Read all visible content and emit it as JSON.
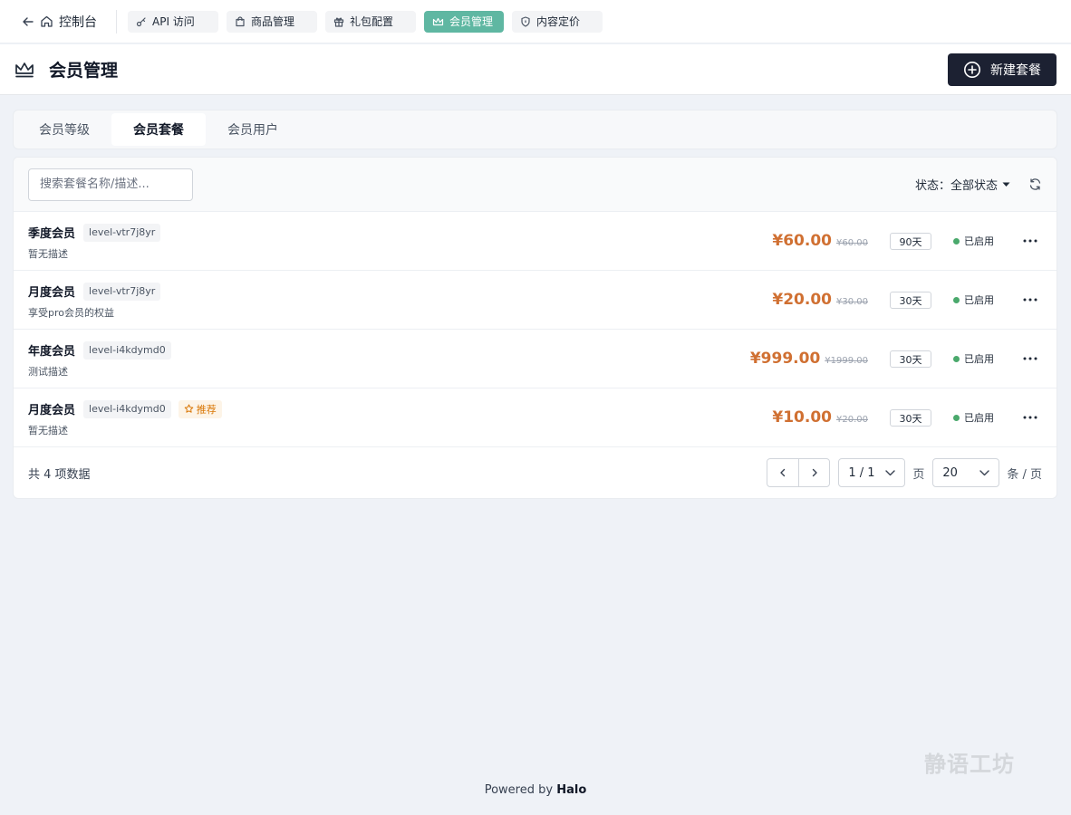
{
  "nav": {
    "back_label": "控制台",
    "tabs": [
      {
        "label": "API 访问",
        "icon": "key-icon"
      },
      {
        "label": "商品管理",
        "icon": "shopping-bag-icon"
      },
      {
        "label": "礼包配置",
        "icon": "gift-icon"
      },
      {
        "label": "会员管理",
        "icon": "crown-icon",
        "active": true
      },
      {
        "label": "内容定价",
        "icon": "shield-icon"
      }
    ],
    "active_color": "#5fb7a2"
  },
  "header": {
    "title": "会员管理",
    "new_button": "新建套餐",
    "button_color": "#1c2132"
  },
  "subtabs": [
    {
      "label": "会员等级",
      "active": false
    },
    {
      "label": "会员套餐",
      "active": true
    },
    {
      "label": "会员用户",
      "active": false
    }
  ],
  "toolbar": {
    "search_placeholder": "搜索套餐名称/描述...",
    "status_label": "状态：",
    "status_value": "全部状态"
  },
  "plans": [
    {
      "name": "季度会员",
      "level": "level-vtr7j8yr",
      "desc": "暂无描述",
      "price": "¥60.00",
      "old_price": "¥60.00",
      "days": "90天",
      "status": "已启用",
      "recommended": false
    },
    {
      "name": "月度会员",
      "level": "level-vtr7j8yr",
      "desc": "享受pro会员的权益",
      "price": "¥20.00",
      "old_price": "¥30.00",
      "days": "30天",
      "status": "已启用",
      "recommended": false
    },
    {
      "name": "年度会员",
      "level": "level-i4kdymd0",
      "desc": "测试描述",
      "price": "¥999.00",
      "old_price": "¥1999.00",
      "days": "30天",
      "status": "已启用",
      "recommended": false
    },
    {
      "name": "月度会员",
      "level": "level-i4kdymd0",
      "desc": "暂无描述",
      "price": "¥10.00",
      "old_price": "¥20.00",
      "days": "30天",
      "status": "已启用",
      "recommended": true,
      "recommend_label": "推荐"
    }
  ],
  "colors": {
    "price": "#d07032",
    "status_dot": "#4aa96c"
  },
  "pagination": {
    "total": "共 4 项数据",
    "page": "1 / 1",
    "page_unit": "页",
    "size": "20",
    "size_unit": "条 / 页"
  },
  "watermark": "静语工坊",
  "footer": {
    "prefix": "Powered by",
    "brand": "Halo"
  }
}
